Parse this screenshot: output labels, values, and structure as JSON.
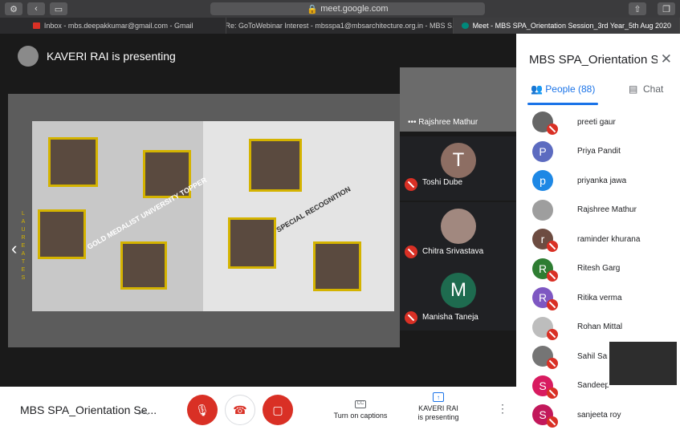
{
  "browser": {
    "url": "meet.google.com",
    "tabs": [
      {
        "label": "Inbox - mbs.deepakkumar@gmail.com - Gmail",
        "active": false
      },
      {
        "label": "Re: GoToWebinar Interest - mbsspa1@mbsarchitecture.org.in - MBS S...",
        "active": false
      },
      {
        "label": "Meet - MBS SPA_Orientation Session_3rd Year_5th Aug 2020",
        "active": true
      }
    ]
  },
  "stage": {
    "presenter_label": "KAVERI RAI is presenting",
    "slide": {
      "text_1": "GOLD MEDALIST UNIVERSITY TOPPER",
      "text_2": "SPECIAL RECOGNITION",
      "side_letters": [
        "L",
        "A",
        "U",
        "R",
        "E",
        "A",
        "T",
        "E",
        "S"
      ]
    }
  },
  "tiles": [
    {
      "name": "Rajshree Mathur",
      "type": "video"
    },
    {
      "name": "Toshi Dube",
      "initial": "T",
      "color": "#8d6e63"
    },
    {
      "name": "Chitra Srivastava",
      "initial": "",
      "color": "#a1887f"
    },
    {
      "name": "Manisha Taneja",
      "initial": "M",
      "color": "#1e6b4f"
    }
  ],
  "panel": {
    "title": "MBS SPA_Orientation Sessio...",
    "tabs": {
      "people": "People (88)",
      "chat": "Chat"
    },
    "participants": [
      {
        "name": "preeti gaur",
        "initial": "",
        "color": "#666666",
        "muted": true
      },
      {
        "name": "Priya Pandit",
        "initial": "P",
        "color": "#5c6bc0",
        "muted": false
      },
      {
        "name": "priyanka jawa",
        "initial": "p",
        "color": "#1e88e5",
        "muted": false
      },
      {
        "name": "Rajshree Mathur",
        "initial": "",
        "color": "#9e9e9e",
        "muted": false
      },
      {
        "name": "raminder khurana",
        "initial": "r",
        "color": "#6d4c41",
        "muted": true
      },
      {
        "name": "Ritesh Garg",
        "initial": "R",
        "color": "#2e7d32",
        "muted": true
      },
      {
        "name": "Ritika verma",
        "initial": "R",
        "color": "#7e57c2",
        "muted": true
      },
      {
        "name": "Rohan Mittal",
        "initial": "",
        "color": "#bdbdbd",
        "muted": true
      },
      {
        "name": "Sahil Sarf",
        "initial": "",
        "color": "#757575",
        "muted": true
      },
      {
        "name": "Sandeep",
        "initial": "S",
        "color": "#d81b60",
        "muted": true
      },
      {
        "name": "sanjeeta roy",
        "initial": "S",
        "color": "#c2185b",
        "muted": true
      }
    ]
  },
  "bottom": {
    "meeting_name": "MBS SPA_Orientation Se...",
    "captions_label": "Turn on captions",
    "captions_icon_text": "CC",
    "present_line1": "KAVERI RAI",
    "present_line2": "is presenting"
  }
}
